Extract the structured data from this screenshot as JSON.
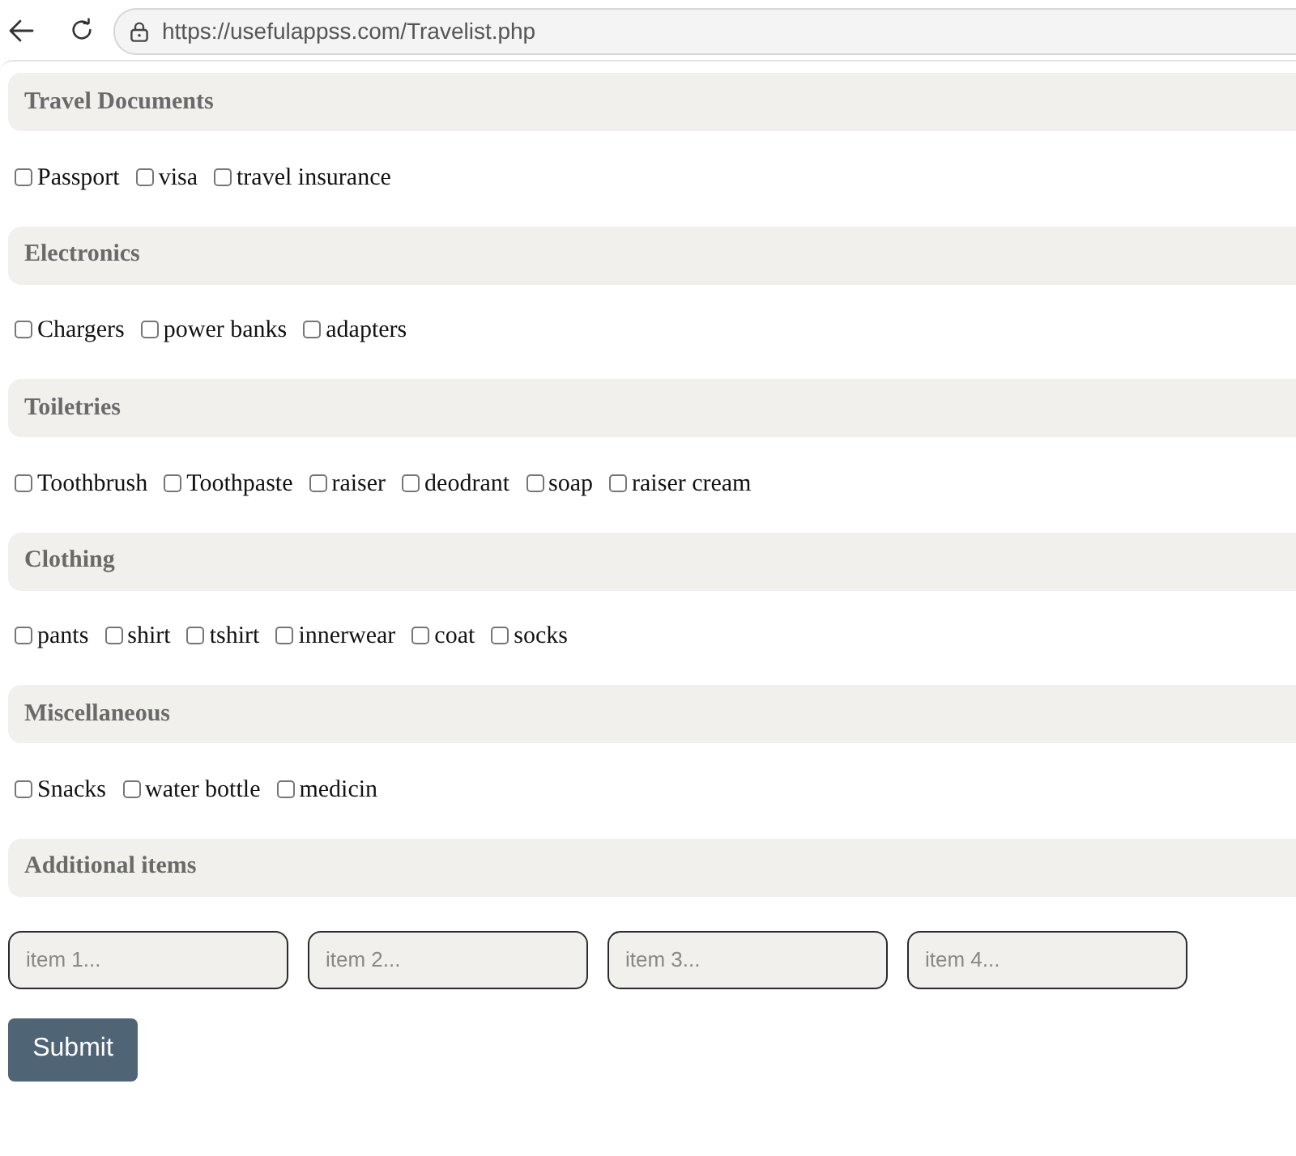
{
  "browser": {
    "url": "https://usefulappss.com/Travelist.php"
  },
  "sections": [
    {
      "title": "Travel Documents",
      "kind": "checklist",
      "items": [
        {
          "label": "Passport",
          "checked": false
        },
        {
          "label": "visa",
          "checked": false
        },
        {
          "label": "travel insurance",
          "checked": false
        }
      ]
    },
    {
      "title": "Electronics",
      "kind": "checklist",
      "items": [
        {
          "label": "Chargers",
          "checked": false
        },
        {
          "label": "power banks",
          "checked": false
        },
        {
          "label": "adapters",
          "checked": false
        }
      ]
    },
    {
      "title": "Toiletries",
      "kind": "checklist",
      "items": [
        {
          "label": "Toothbrush",
          "checked": false
        },
        {
          "label": "Toothpaste",
          "checked": false
        },
        {
          "label": "raiser",
          "checked": false
        },
        {
          "label": "deodrant",
          "checked": false
        },
        {
          "label": "soap",
          "checked": false
        },
        {
          "label": "raiser cream",
          "checked": false
        }
      ]
    },
    {
      "title": "Clothing",
      "kind": "checklist",
      "items": [
        {
          "label": "pants",
          "checked": false
        },
        {
          "label": "shirt",
          "checked": false
        },
        {
          "label": "tshirt",
          "checked": false
        },
        {
          "label": "innerwear",
          "checked": false
        },
        {
          "label": "coat",
          "checked": false
        },
        {
          "label": "socks",
          "checked": false
        }
      ]
    },
    {
      "title": "Miscellaneous",
      "kind": "checklist",
      "items": [
        {
          "label": "Snacks",
          "checked": false
        },
        {
          "label": "water bottle",
          "checked": false
        },
        {
          "label": "medicin",
          "checked": false
        }
      ]
    },
    {
      "title": "Additional items",
      "kind": "fields",
      "fields": [
        {
          "placeholder": "item 1..."
        },
        {
          "placeholder": "item 2..."
        },
        {
          "placeholder": "item 3..."
        },
        {
          "placeholder": "item 4..."
        }
      ]
    }
  ],
  "submit": {
    "label": "Submit"
  }
}
